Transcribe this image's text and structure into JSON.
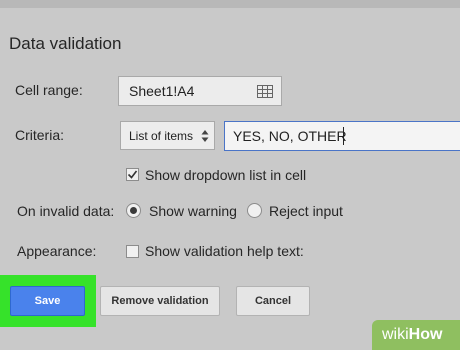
{
  "dialog": {
    "title": "Data validation"
  },
  "cell_range": {
    "label": "Cell range:",
    "value": "Sheet1!A4",
    "icon": "grid-icon"
  },
  "criteria": {
    "label": "Criteria:",
    "type_value": "List of items",
    "input_value": "YES, NO, OTHER"
  },
  "dropdown_option": {
    "label": "Show dropdown list in cell",
    "checked": true
  },
  "invalid_data": {
    "label": "On invalid data:",
    "options": [
      {
        "label": "Show warning",
        "selected": true
      },
      {
        "label": "Reject input",
        "selected": false
      }
    ]
  },
  "appearance": {
    "label": "Appearance:",
    "help_text_label": "Show validation help text:",
    "checked": false
  },
  "buttons": {
    "save": "Save",
    "remove": "Remove validation",
    "cancel": "Cancel"
  },
  "watermark": {
    "part1": "wiki",
    "part2": "How"
  },
  "colors": {
    "highlight": "#36e22a",
    "save_button": "#4a82ec",
    "input_focus_border": "#4a74c7"
  }
}
